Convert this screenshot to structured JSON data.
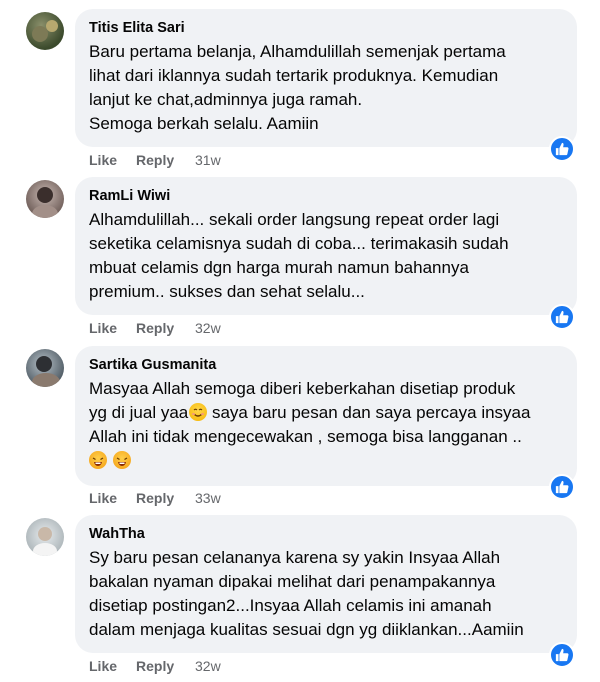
{
  "comments": [
    {
      "author": "Titis Elita Sari",
      "lines": [
        "Baru pertama belanja, Alhamdulillah semenjak pertama",
        "lihat dari iklannya sudah tertarik produknya. Kemudian",
        "lanjut ke chat,adminnya juga ramah.",
        "Semoga berkah selalu. Aamiin"
      ],
      "like_label": "Like",
      "reply_label": "Reply",
      "time": "31w"
    },
    {
      "author": "RamLi Wiwi",
      "lines": [
        "Alhamdulillah... sekali order langsung repeat order lagi",
        "seketika celamisnya sudah di coba... terimakasih sudah",
        "mbuat celamis dgn harga murah namun bahannya",
        "premium.. sukses dan sehat selalu..."
      ],
      "like_label": "Like",
      "reply_label": "Reply",
      "time": "32w"
    },
    {
      "author": "Sartika Gusmanita",
      "lines": [
        "Masyaa Allah semoga diberi keberkahan disetiap produk",
        "yg di jual yaa",
        "saya baru pesan dan saya percaya insyaa",
        "Allah ini tidak mengecewakan , semoga bisa langganan .."
      ],
      "like_label": "Like",
      "reply_label": "Reply",
      "time": "33w"
    },
    {
      "author": "WahTha",
      "lines": [
        "Sy baru pesan celananya karena sy yakin Insyaa Allah",
        "bakalan nyaman dipakai melihat dari penampakannya",
        "disetiap postingan2...Insyaa Allah celamis ini amanah",
        "dalam menjaga kualitas sesuai dgn yg diiklankan...Aamiin"
      ],
      "like_label": "Like",
      "reply_label": "Reply",
      "time": "32w"
    }
  ],
  "icons": {
    "avatar": "avatar",
    "reaction": "thumbs-up-icon",
    "emoji_smile": "smiling-face-emoji",
    "emoji_hot": "hot-face-emoji"
  },
  "colors": {
    "bubble": "#f0f2f5",
    "secondary_text": "#65676b",
    "like_blue": "#1877f2"
  }
}
